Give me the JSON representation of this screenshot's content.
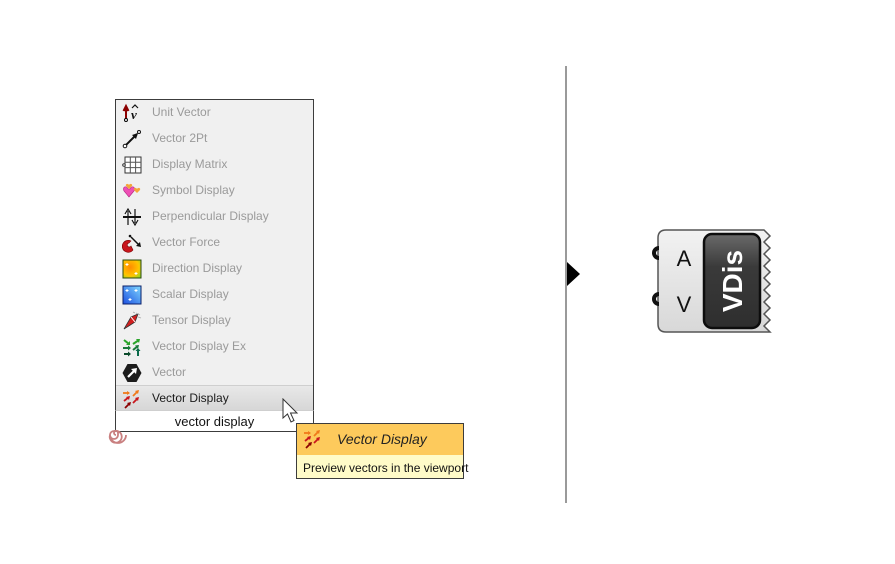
{
  "menu": {
    "items": [
      {
        "label": "Unit Vector",
        "icon": "unit-vector-icon"
      },
      {
        "label": "Vector 2Pt",
        "icon": "vector-2pt-icon"
      },
      {
        "label": "Display Matrix",
        "icon": "display-matrix-icon"
      },
      {
        "label": "Symbol Display",
        "icon": "symbol-display-icon"
      },
      {
        "label": "Perpendicular Display",
        "icon": "perpendicular-display-icon"
      },
      {
        "label": "Vector Force",
        "icon": "vector-force-icon"
      },
      {
        "label": "Direction Display",
        "icon": "direction-display-icon"
      },
      {
        "label": "Scalar Display",
        "icon": "scalar-display-icon"
      },
      {
        "label": "Tensor Display",
        "icon": "tensor-display-icon"
      },
      {
        "label": "Vector Display Ex",
        "icon": "vector-display-ex-icon"
      },
      {
        "label": "Vector",
        "icon": "vector-icon"
      },
      {
        "label": "Vector Display",
        "icon": "vector-display-icon",
        "selected": true
      }
    ]
  },
  "search": {
    "value": "vector display"
  },
  "tooltip": {
    "title": "Vector Display",
    "description": "Preview vectors in the viewport",
    "header_color": "#fdca5c",
    "body_color": "#fffbc8"
  },
  "component": {
    "nickname": "VDis",
    "inputs": [
      "A",
      "V"
    ]
  }
}
